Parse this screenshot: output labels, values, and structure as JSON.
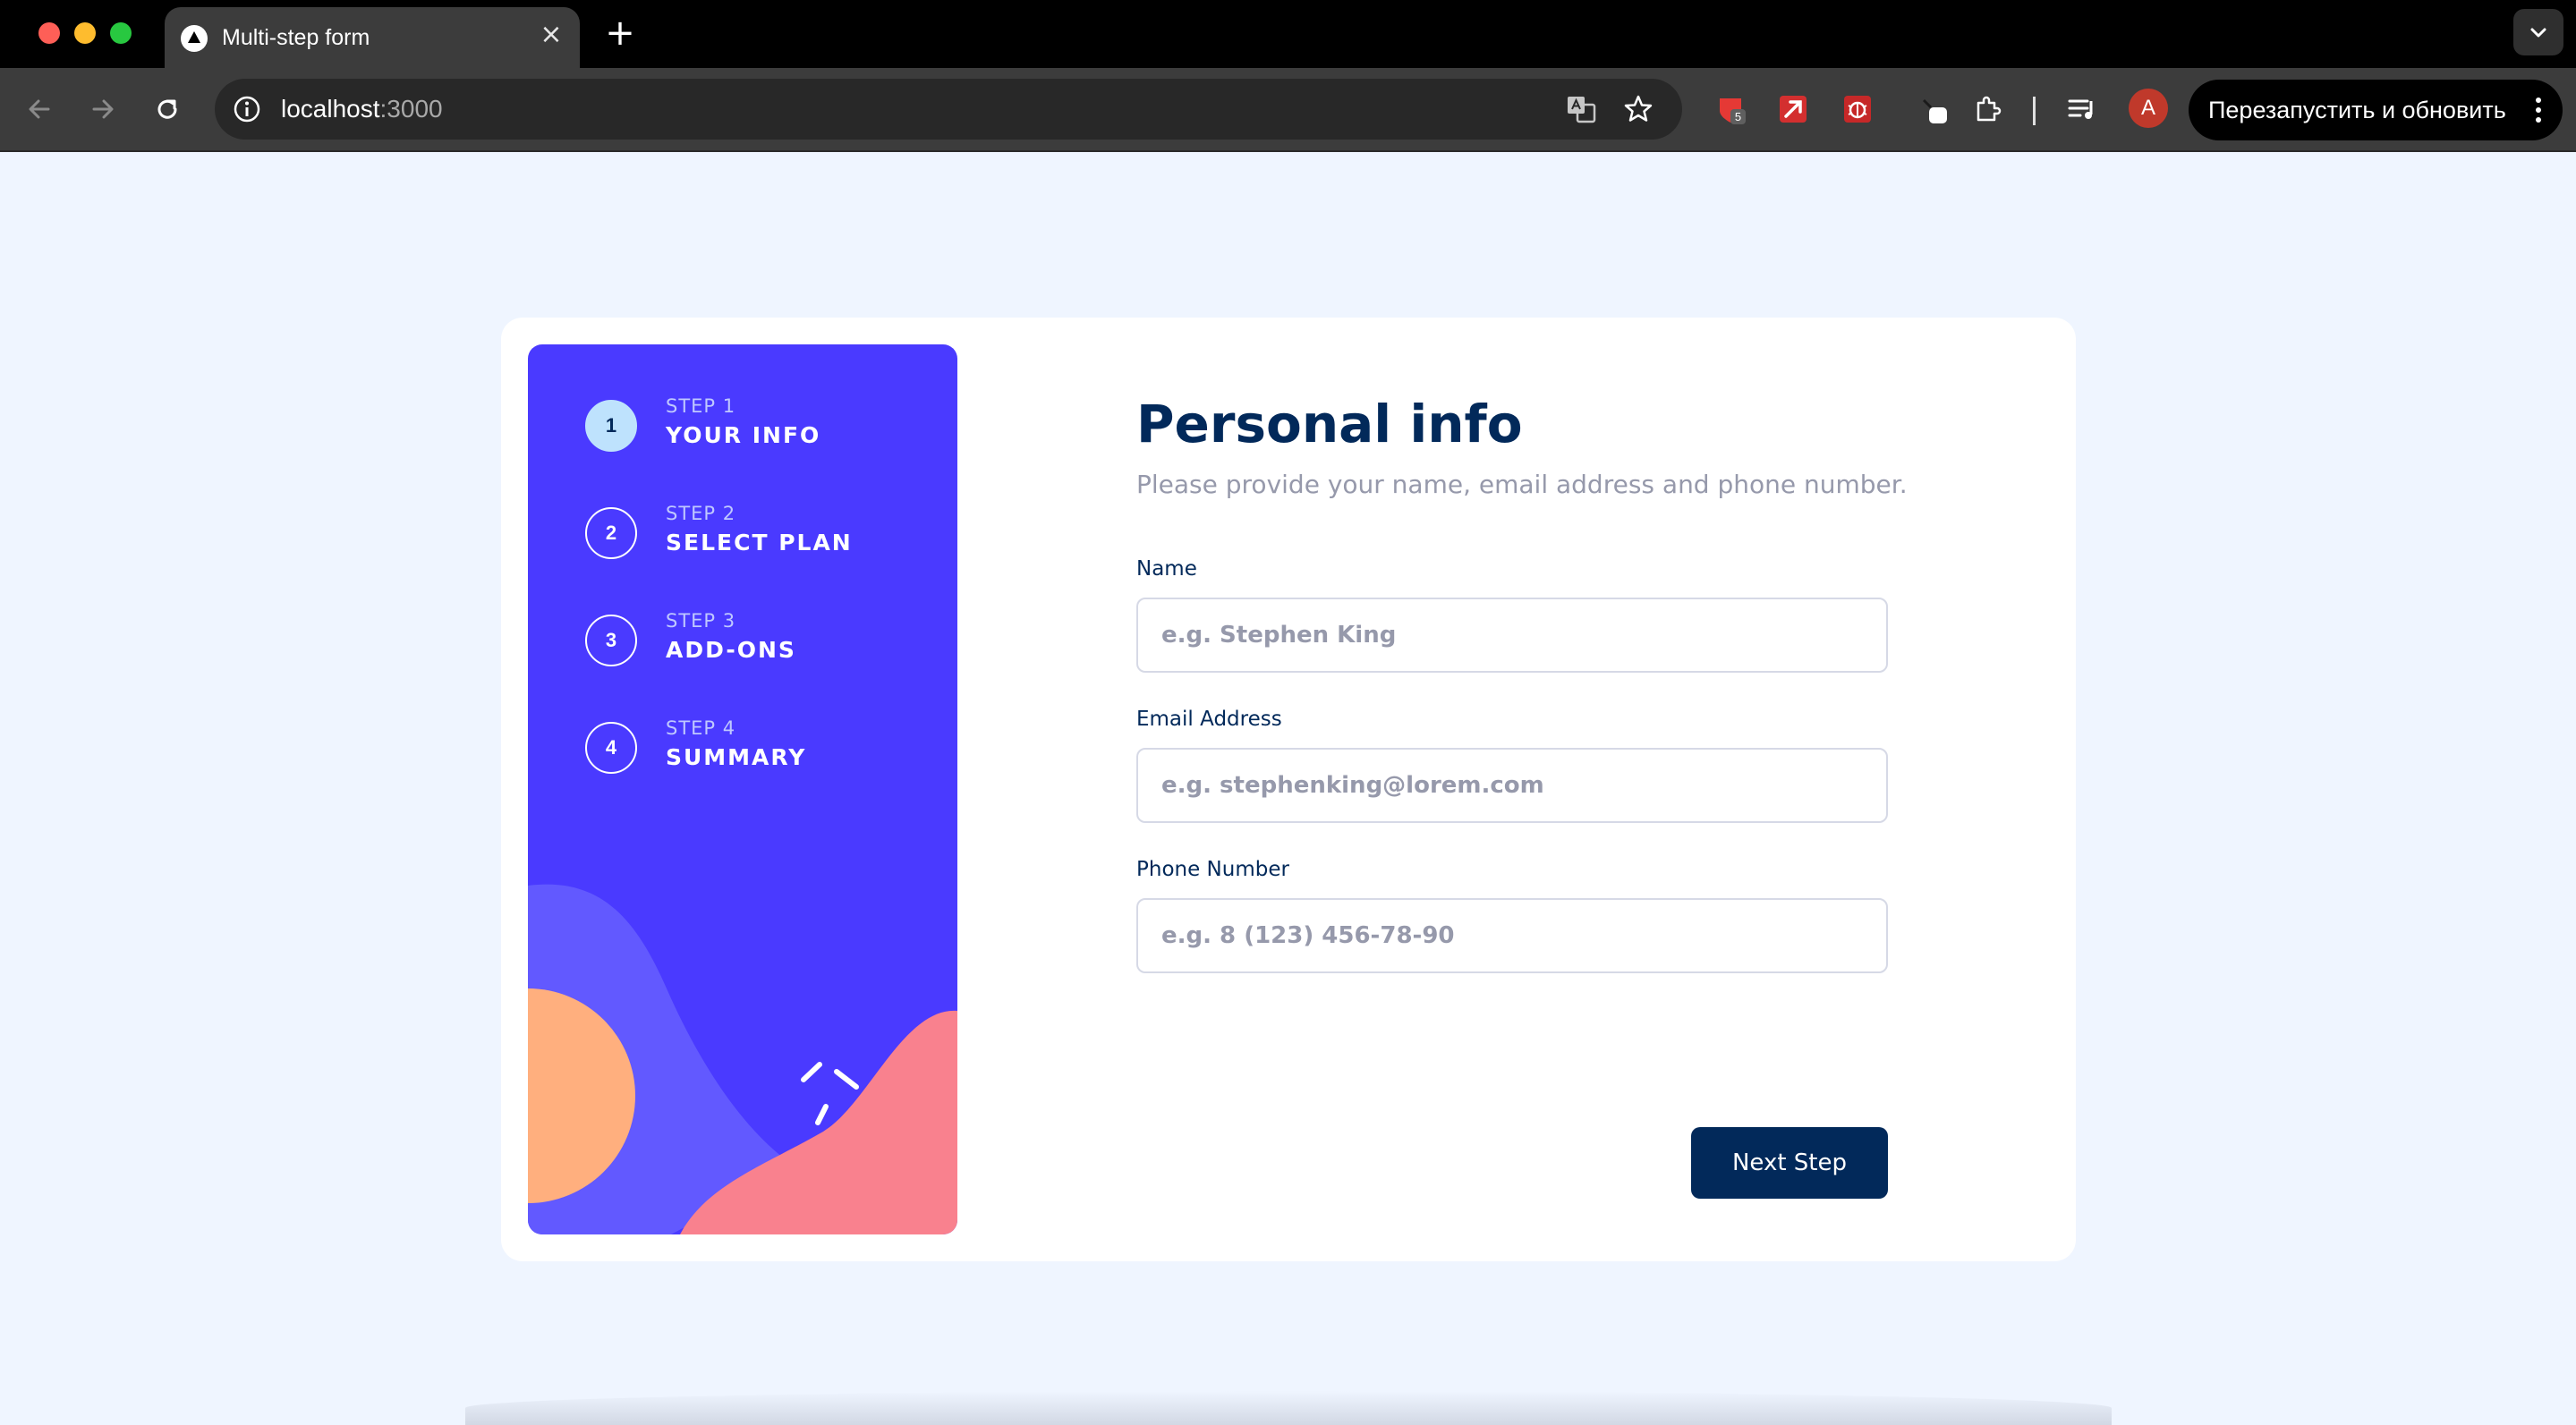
{
  "browser": {
    "tab_title": "Multi-step form",
    "tab_close": "×",
    "new_tab": "+",
    "url_host": "localhost",
    "url_port": ":3000",
    "extension_badge": "5",
    "profile_initial": "A",
    "restart_label": "Перезапустить и обновить"
  },
  "sidebar": {
    "steps": [
      {
        "number": "1",
        "label": "STEP 1",
        "title": "YOUR INFO",
        "active": true
      },
      {
        "number": "2",
        "label": "STEP 2",
        "title": "SELECT PLAN",
        "active": false
      },
      {
        "number": "3",
        "label": "STEP 3",
        "title": "ADD-ONS",
        "active": false
      },
      {
        "number": "4",
        "label": "STEP 4",
        "title": "SUMMARY",
        "active": false
      }
    ]
  },
  "form": {
    "title": "Personal info",
    "subtitle": "Please provide your name, email address and phone number.",
    "fields": [
      {
        "label": "Name",
        "value": "",
        "placeholder": "e.g. Stephen King"
      },
      {
        "label": "Email Address",
        "value": "",
        "placeholder": "e.g. stephenking@lorem.com"
      },
      {
        "label": "Phone Number",
        "value": "",
        "placeholder": "e.g. 8 (123) 456-78-90"
      }
    ],
    "next_label": "Next Step"
  },
  "colors": {
    "page_bg": "#eff5ff",
    "sidebar_bg": "#4a3aff",
    "primary_dark": "#02295a",
    "active_step": "#bee2fd",
    "muted_text": "#9699ab",
    "border": "#d6d9e6",
    "deco_orange": "#ffaf7e",
    "deco_pink": "#f9818e",
    "deco_purple": "#6259ff"
  },
  "icons": [
    "back-arrow-icon",
    "forward-arrow-icon",
    "reload-icon",
    "info-icon",
    "translate-icon",
    "star-icon",
    "extensions-icon",
    "media-control-icon",
    "kebab-menu-icon"
  ]
}
